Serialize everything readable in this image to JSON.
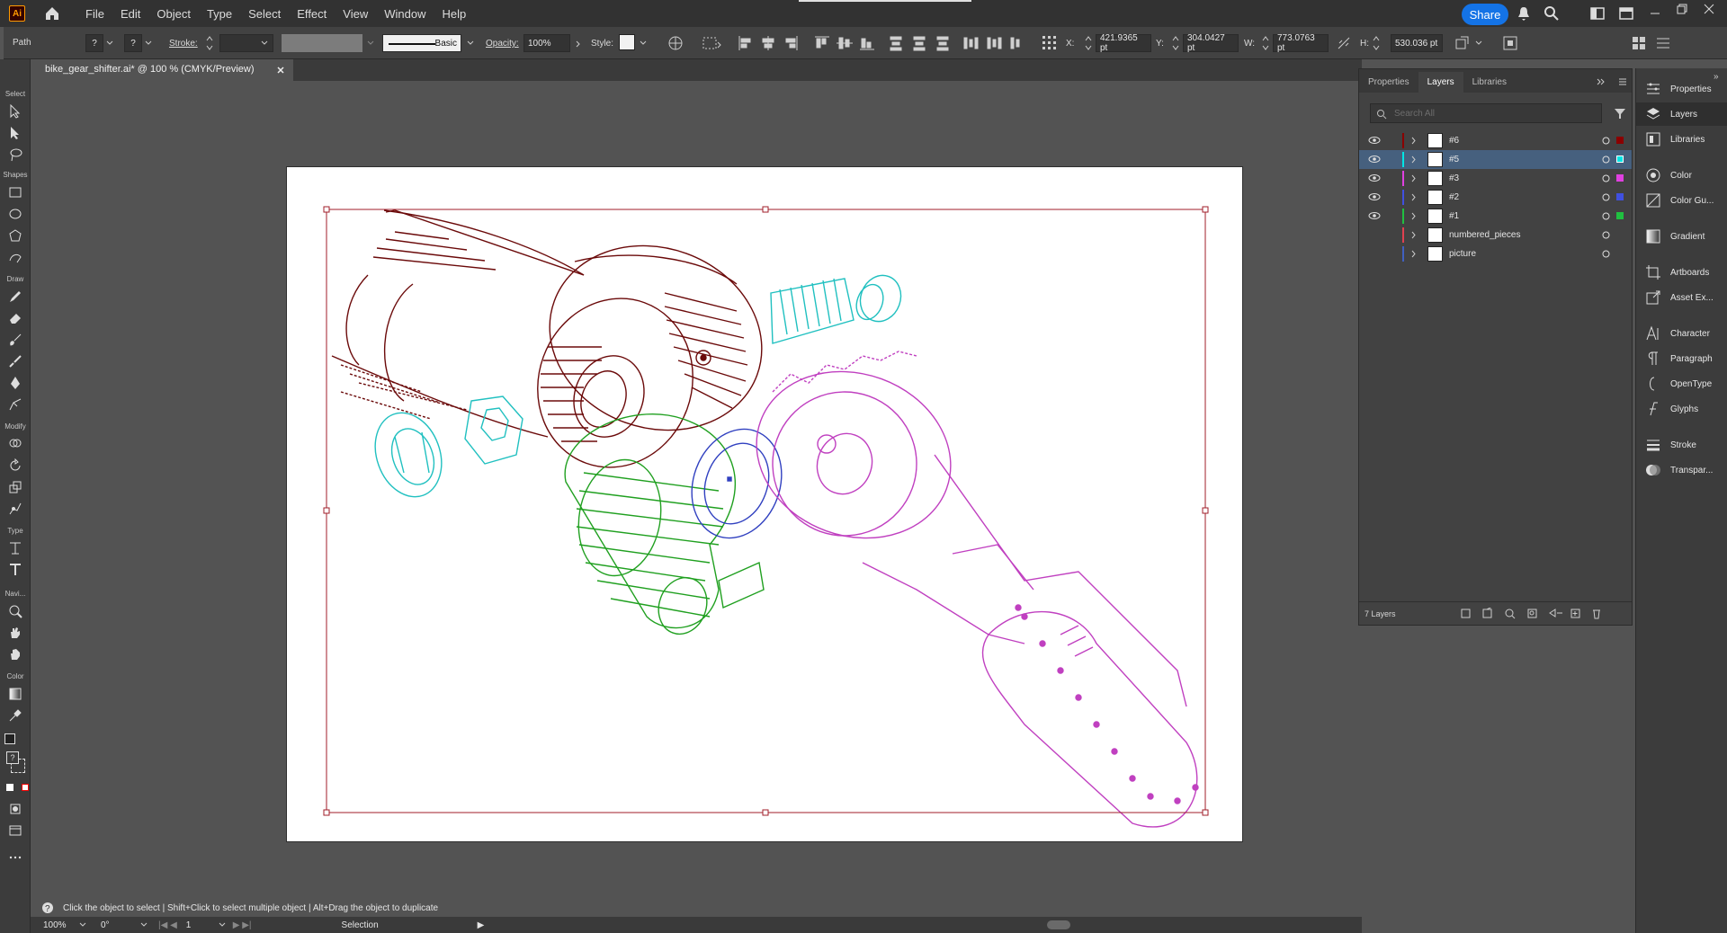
{
  "menubar": {
    "app_logo": "Ai",
    "items": [
      "File",
      "Edit",
      "Object",
      "Type",
      "Select",
      "Effect",
      "View",
      "Window",
      "Help"
    ],
    "share_label": "Share"
  },
  "controlbar": {
    "selection_type": "Path",
    "stroke_label": "Stroke:",
    "brush_label": "Basic",
    "opacity_label": "Opacity:",
    "opacity_value": "100%",
    "style_label": "Style:",
    "x_label": "X:",
    "x_value": "421.9365 pt",
    "y_label": "Y:",
    "y_value": "304.0427 pt",
    "w_label": "W:",
    "w_value": "773.0763 pt",
    "h_label": "H:",
    "h_value": "530.036 pt"
  },
  "document": {
    "tab_title": "bike_gear_shifter.ai* @ 100 % (CMYK/Preview)"
  },
  "toolbar": {
    "groups": [
      "Select",
      "Shapes",
      "Draw",
      "Modify",
      "Type",
      "Navi...",
      "Color"
    ]
  },
  "status": {
    "hint": "Click the object to select  |  Shift+Click to select multiple object  |  Alt+Drag the object to duplicate",
    "zoom": "100%",
    "rotation": "0°",
    "artboard_number": "1",
    "tool_name": "Selection"
  },
  "layers_panel": {
    "tabs": [
      "Properties",
      "Layers",
      "Libraries"
    ],
    "active_tab": "Layers",
    "search_placeholder": "Search All",
    "layers": [
      {
        "name": "#6",
        "color": "#8b0000",
        "visible": true,
        "selected": false
      },
      {
        "name": "#5",
        "color": "#00e5e5",
        "visible": true,
        "selected": true
      },
      {
        "name": "#3",
        "color": "#e040e0",
        "visible": true,
        "selected": false
      },
      {
        "name": "#2",
        "color": "#4050e0",
        "visible": true,
        "selected": false
      },
      {
        "name": "#1",
        "color": "#20c040",
        "visible": true,
        "selected": false
      },
      {
        "name": "numbered_pieces",
        "color": "#e04050",
        "visible": false,
        "selected": false
      },
      {
        "name": "picture",
        "color": "#4060c0",
        "visible": false,
        "selected": false
      }
    ],
    "footer_count": "7 Layers"
  },
  "right_dock": {
    "items": [
      "Properties",
      "Layers",
      "Libraries",
      "Color",
      "Color Gu...",
      "Gradient",
      "Artboards",
      "Asset Ex...",
      "Character",
      "Paragraph",
      "OpenType",
      "Glyphs",
      "Stroke",
      "Transpar..."
    ]
  },
  "colors": {
    "selection_bbox": "#a01e28",
    "wrench": "#c040c0",
    "handlebar": "#6b0a0a",
    "bolt": "#20c0c0",
    "clamp": "#20a020",
    "ring": "#3040c0"
  }
}
